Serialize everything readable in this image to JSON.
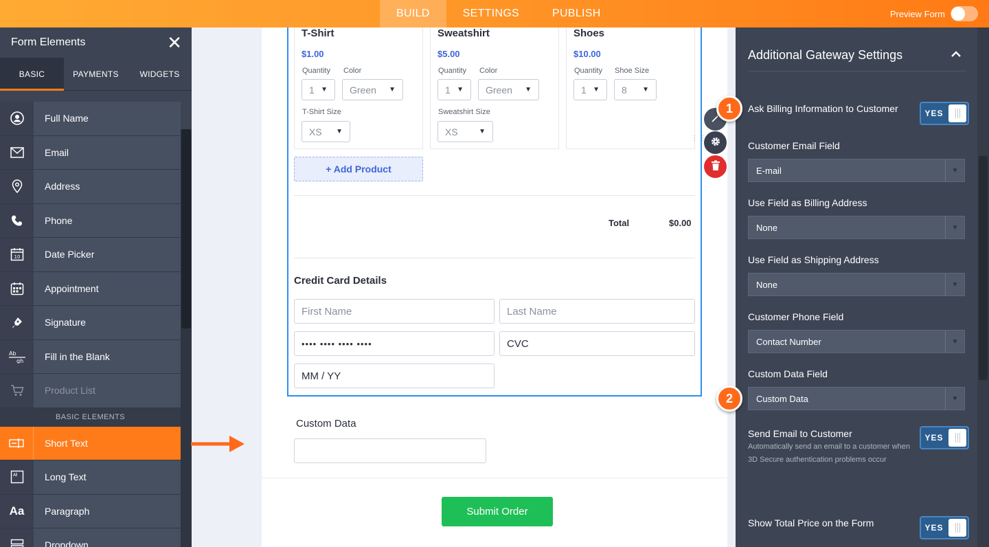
{
  "topbar": {
    "tabs": [
      "BUILD",
      "SETTINGS",
      "PUBLISH"
    ],
    "active_tab": "BUILD",
    "preview_label": "Preview Form"
  },
  "left_panel": {
    "title": "Form Elements",
    "tabs": [
      "BASIC",
      "PAYMENTS",
      "WIDGETS"
    ],
    "items": [
      {
        "label": "Full Name",
        "icon": "user-circle-icon"
      },
      {
        "label": "Email",
        "icon": "envelope-icon"
      },
      {
        "label": "Address",
        "icon": "map-pin-icon"
      },
      {
        "label": "Phone",
        "icon": "phone-icon"
      },
      {
        "label": "Date Picker",
        "icon": "calendar-icon"
      },
      {
        "label": "Appointment",
        "icon": "appointment-calendar-icon"
      },
      {
        "label": "Signature",
        "icon": "pen-icon"
      },
      {
        "label": "Fill in the Blank",
        "icon": "fill-blank-icon"
      },
      {
        "label": "Product List",
        "icon": "cart-icon"
      }
    ],
    "section_label": "BASIC ELEMENTS",
    "items2": [
      {
        "label": "Short Text",
        "icon": "short-text-icon"
      },
      {
        "label": "Long Text",
        "icon": "long-text-icon"
      },
      {
        "label": "Paragraph",
        "icon": "paragraph-icon"
      },
      {
        "label": "Dropdown",
        "icon": "dropdown-icon"
      }
    ]
  },
  "form": {
    "products": [
      {
        "name": "T-Shirt",
        "price": "$1.00",
        "qty_label": "Quantity",
        "qty": "1",
        "opt_label": "Color",
        "opt": "Green",
        "size_label": "T-Shirt Size",
        "size": "XS"
      },
      {
        "name": "Sweatshirt",
        "price": "$5.00",
        "qty_label": "Quantity",
        "qty": "1",
        "opt_label": "Color",
        "opt": "Green",
        "size_label": "Sweatshirt Size",
        "size": "XS"
      },
      {
        "name": "Shoes",
        "price": "$10.00",
        "qty_label": "Quantity",
        "qty": "1",
        "opt_label": "Shoe Size",
        "opt": "8"
      }
    ],
    "add_product": "+ Add Product",
    "total_label": "Total",
    "total_value": "$0.00",
    "credit_card_title": "Credit Card Details",
    "first_name_ph": "First Name",
    "last_name_ph": "Last Name",
    "card_number": "•••• •••• •••• ••••",
    "cvc": "CVC",
    "expiry_ph": "MM / YY",
    "custom_data_label": "Custom Data",
    "submit": "Submit Order"
  },
  "right_panel": {
    "title": "Additional Gateway Settings",
    "ask_billing": "Ask Billing Information to Customer",
    "yes": "YES",
    "customer_email_label": "Customer Email Field",
    "customer_email_value": "E-mail",
    "billing_addr_label": "Use Field as Billing Address",
    "billing_addr_value": "None",
    "shipping_addr_label": "Use Field as Shipping Address",
    "shipping_addr_value": "None",
    "phone_label": "Customer Phone Field",
    "phone_value": "Contact Number",
    "custom_data_label": "Custom Data Field",
    "custom_data_value": "Custom Data",
    "send_email_label": "Send Email to Customer",
    "send_email_desc": "Automatically send an email to a customer when 3D Secure authentication problems occur",
    "show_total_label": "Show Total Price on the Form"
  },
  "badges": [
    "1",
    "2"
  ],
  "colors": {
    "accent": "#ff7b1a",
    "panel": "#3d4453",
    "link": "#3e66d6",
    "submit": "#1fbf57",
    "toggle": "#2c5d8f"
  }
}
